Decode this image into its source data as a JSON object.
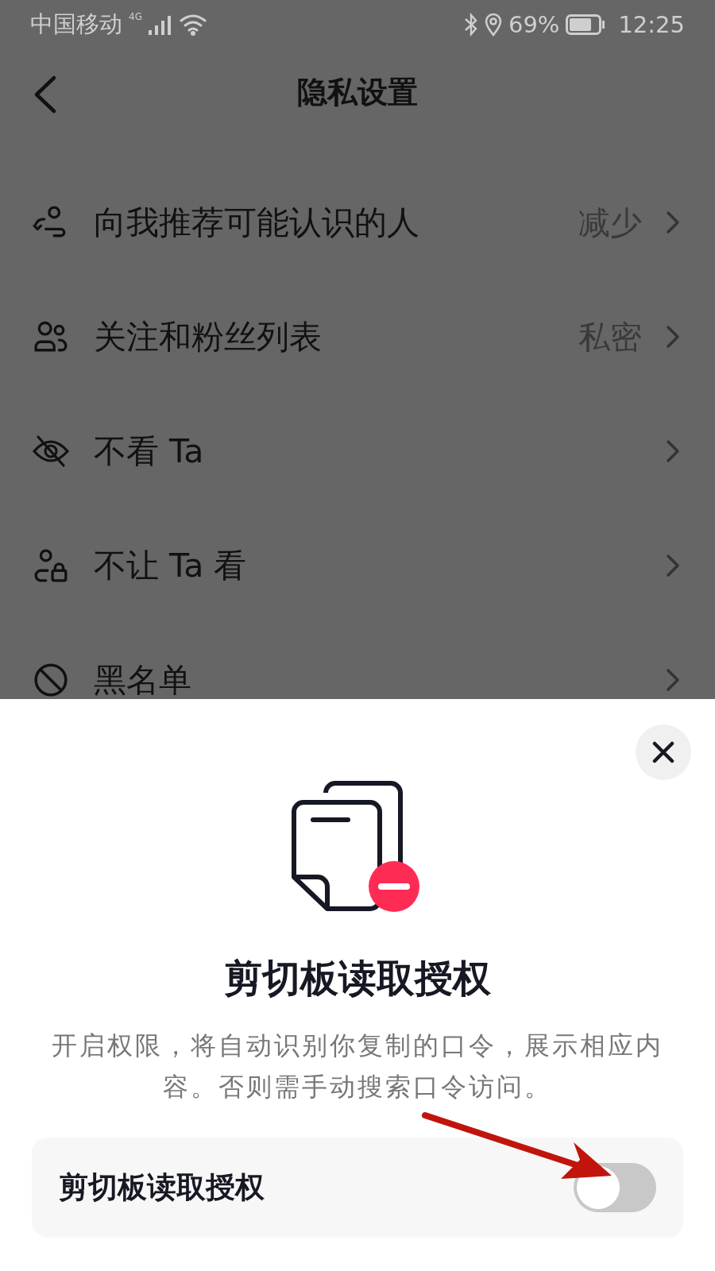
{
  "status_bar": {
    "carrier": "中国移动",
    "network": "4G",
    "battery": "69%",
    "time": "12:25"
  },
  "header": {
    "title": "隐私设置"
  },
  "settings": [
    {
      "label": "向我推荐可能认识的人",
      "value": "减少"
    },
    {
      "label": "关注和粉丝列表",
      "value": "私密"
    },
    {
      "label": "不看 Ta"
    },
    {
      "label": "不让 Ta 看"
    },
    {
      "label": "黑名单"
    }
  ],
  "dialog": {
    "title": "剪切板读取授权",
    "description": "开启权限，将自动识别你复制的口令，展示相应内容。否则需手动搜索口令访问。",
    "toggle": {
      "label": "剪切板读取授权",
      "on": false
    }
  }
}
